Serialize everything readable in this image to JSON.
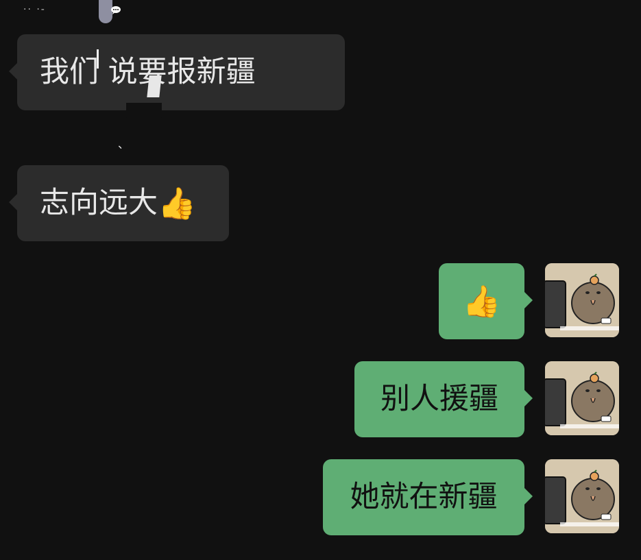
{
  "header": {
    "clipped_name": "·· ·-"
  },
  "messages": {
    "incoming": [
      {
        "text": "我们 说要报新疆"
      },
      {
        "text": "志向远大",
        "emoji": "👍"
      }
    ],
    "outgoing": [
      {
        "emoji": "👍"
      },
      {
        "text": "别人援疆"
      },
      {
        "text": "她就在新疆"
      }
    ]
  },
  "icons": {
    "chat": "chat-bubble-icon",
    "avatar": "capybara-avatar"
  },
  "colors": {
    "background": "#111111",
    "incoming_bubble": "#2c2c2c",
    "outgoing_bubble": "#5fae74"
  }
}
